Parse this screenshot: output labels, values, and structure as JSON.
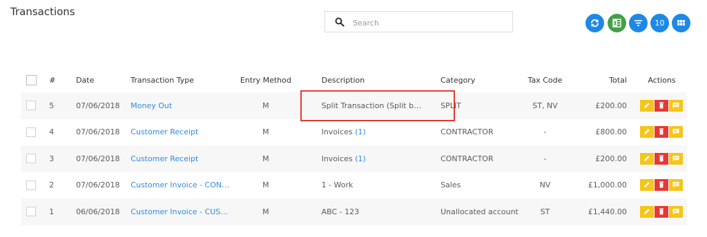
{
  "page": {
    "title": "Transactions"
  },
  "search": {
    "placeholder": "Search",
    "value": ""
  },
  "toolbar": {
    "refresh_icon": "refresh-icon",
    "excel_icon": "excel-icon",
    "filter_icon": "filter-icon",
    "page_size": "10",
    "grid_icon": "grid-icon"
  },
  "table": {
    "headers": {
      "number": "#",
      "date": "Date",
      "type": "Transaction Type",
      "entry": "Entry Method",
      "description": "Description",
      "category": "Category",
      "tax": "Tax Code",
      "total": "Total",
      "actions": "Actions"
    },
    "rows": [
      {
        "num": "5",
        "date": "07/06/2018",
        "type": "Money Out",
        "entry": "M",
        "description": "Split Transaction (Split b…",
        "desc_count": "",
        "category": "SPLIT",
        "tax": "ST, NV",
        "total": "£200.00"
      },
      {
        "num": "4",
        "date": "07/06/2018",
        "type": "Customer Receipt",
        "entry": "M",
        "description": "Invoices",
        "desc_count": "(1)",
        "category": "CONTRACTOR",
        "tax": "-",
        "total": "£800.00"
      },
      {
        "num": "3",
        "date": "07/06/2018",
        "type": "Customer Receipt",
        "entry": "M",
        "description": "Invoices",
        "desc_count": "(1)",
        "category": "CONTRACTOR",
        "tax": "-",
        "total": "£200.00"
      },
      {
        "num": "2",
        "date": "07/06/2018",
        "type": "Customer Invoice - CON…",
        "entry": "M",
        "description": "1 - Work",
        "desc_count": "",
        "category": "Sales",
        "tax": "NV",
        "total": "£1,000.00"
      },
      {
        "num": "1",
        "date": "06/06/2018",
        "type": "Customer Invoice - CUS…",
        "entry": "M",
        "description": "ABC - 123",
        "desc_count": "",
        "category": "Unallocated account",
        "tax": "ST",
        "total": "£1,440.00"
      }
    ]
  },
  "colors": {
    "accent": "#1e88e5",
    "excel": "#43a047",
    "edit": "#f5c518",
    "delete": "#e53935",
    "link": "#2f8ae3",
    "highlight": "#e53935"
  }
}
